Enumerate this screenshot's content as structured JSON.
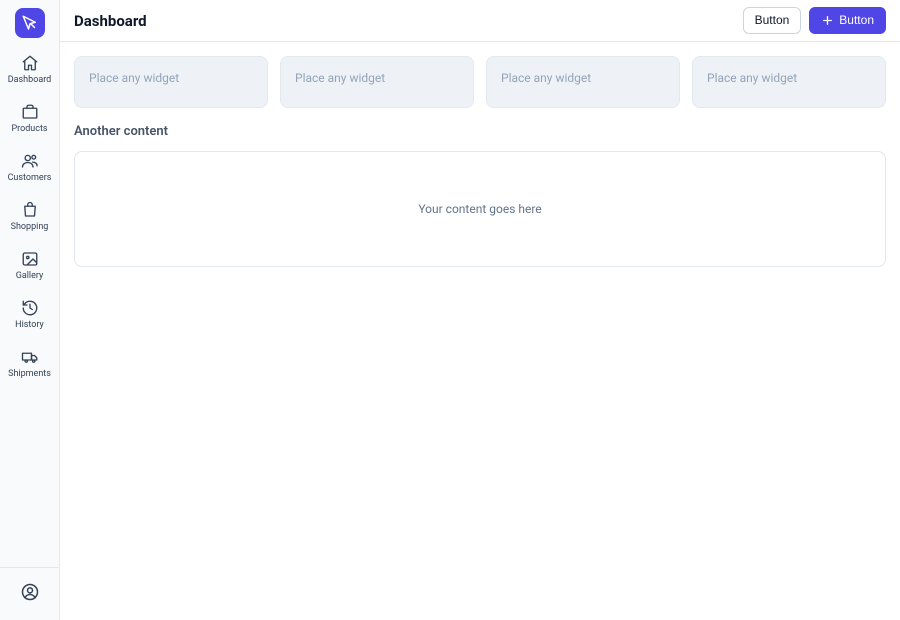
{
  "sidebar": {
    "items": [
      {
        "label": "Dashboard",
        "icon": "home-icon"
      },
      {
        "label": "Products",
        "icon": "package-icon"
      },
      {
        "label": "Customers",
        "icon": "users-icon"
      },
      {
        "label": "Shopping",
        "icon": "shopping-bag-icon"
      },
      {
        "label": "Gallery",
        "icon": "image-icon"
      },
      {
        "label": "History",
        "icon": "history-icon"
      },
      {
        "label": "Shipments",
        "icon": "truck-icon"
      }
    ]
  },
  "header": {
    "title": "Dashboard",
    "secondary_button_label": "Button",
    "primary_button_label": "Button"
  },
  "widgets": [
    {
      "placeholder": "Place any widget"
    },
    {
      "placeholder": "Place any widget"
    },
    {
      "placeholder": "Place any widget"
    },
    {
      "placeholder": "Place any widget"
    }
  ],
  "section": {
    "title": "Another content",
    "body": "Your content goes here"
  }
}
